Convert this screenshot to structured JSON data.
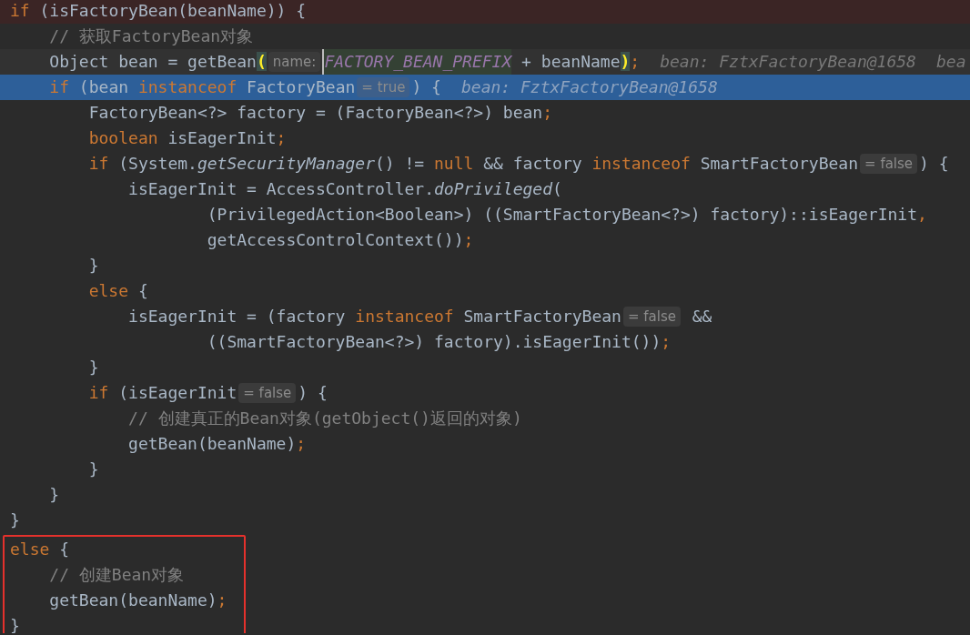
{
  "code_lines": [
    {
      "kind": "breakpoint",
      "tokens": [
        {
          "kind": "keyword",
          "text": "if"
        },
        {
          "kind": "text",
          "text": " (isFactoryBean(beanName)) {"
        }
      ]
    },
    {
      "tokens": [
        {
          "kind": "comment",
          "text": "    // 获取FactoryBean对象"
        }
      ]
    },
    {
      "kind": "caret",
      "tokens": [
        {
          "kind": "text",
          "text": "    Object bean = getBean"
        },
        {
          "kind": "brace",
          "text": "("
        },
        {
          "kind": "hint",
          "text": "name:"
        },
        {
          "kind": "constant",
          "text": "FACTORY_BEAN_PREFIX"
        },
        {
          "kind": "text",
          "text": " + beanName"
        },
        {
          "kind": "brace",
          "text": ")"
        },
        {
          "kind": "keyword",
          "text": ";"
        },
        {
          "kind": "value",
          "text": "bean: FztxFactoryBean@1658"
        },
        {
          "kind": "value",
          "text": "bea"
        }
      ]
    },
    {
      "kind": "execution",
      "tokens": [
        {
          "kind": "keyword",
          "text": "    if"
        },
        {
          "kind": "text",
          "text": " (bean "
        },
        {
          "kind": "keyword",
          "text": "instanceof"
        },
        {
          "kind": "text",
          "text": " FactoryBean"
        },
        {
          "kind": "hint",
          "text": "= true"
        },
        {
          "kind": "text",
          "text": ") {"
        },
        {
          "kind": "value",
          "text": "bean: FztxFactoryBean@1658"
        }
      ]
    },
    {
      "tokens": [
        {
          "kind": "text",
          "text": "        FactoryBean<?> factory = (FactoryBean<?>) bean"
        },
        {
          "kind": "keyword",
          "text": ";"
        }
      ]
    },
    {
      "tokens": [
        {
          "kind": "keyword",
          "text": "        boolean"
        },
        {
          "kind": "text",
          "text": " isEagerInit"
        },
        {
          "kind": "keyword",
          "text": ";"
        }
      ]
    },
    {
      "tokens": [
        {
          "kind": "keyword",
          "text": "        if"
        },
        {
          "kind": "text",
          "text": " (System."
        },
        {
          "kind": "italic",
          "text": "getSecurityManager"
        },
        {
          "kind": "text",
          "text": "() != "
        },
        {
          "kind": "keyword",
          "text": "null"
        },
        {
          "kind": "text",
          "text": " && factory "
        },
        {
          "kind": "keyword",
          "text": "instanceof"
        },
        {
          "kind": "text",
          "text": " SmartFactoryBean"
        },
        {
          "kind": "hint",
          "text": "= false"
        },
        {
          "kind": "text",
          "text": ") {"
        }
      ]
    },
    {
      "tokens": [
        {
          "kind": "text",
          "text": "            isEagerInit = AccessController."
        },
        {
          "kind": "italic",
          "text": "doPrivileged"
        },
        {
          "kind": "text",
          "text": "("
        }
      ]
    },
    {
      "tokens": [
        {
          "kind": "text",
          "text": "                    (PrivilegedAction<Boolean>) ((SmartFactoryBean<?>) factory)::isEagerInit"
        },
        {
          "kind": "keyword",
          "text": ","
        }
      ]
    },
    {
      "tokens": [
        {
          "kind": "text",
          "text": "                    getAccessControlContext())"
        },
        {
          "kind": "keyword",
          "text": ";"
        }
      ]
    },
    {
      "tokens": [
        {
          "kind": "text",
          "text": "        }"
        }
      ]
    },
    {
      "tokens": [
        {
          "kind": "keyword",
          "text": "        else"
        },
        {
          "kind": "text",
          "text": " {"
        }
      ]
    },
    {
      "tokens": [
        {
          "kind": "text",
          "text": "            isEagerInit = (factory "
        },
        {
          "kind": "keyword",
          "text": "instanceof"
        },
        {
          "kind": "text",
          "text": " SmartFactoryBean"
        },
        {
          "kind": "hint",
          "text": "= false"
        },
        {
          "kind": "text",
          "text": " &&"
        }
      ]
    },
    {
      "tokens": [
        {
          "kind": "text",
          "text": "                    ((SmartFactoryBean<?>) factory).isEagerInit())"
        },
        {
          "kind": "keyword",
          "text": ";"
        }
      ]
    },
    {
      "tokens": [
        {
          "kind": "text",
          "text": "        }"
        }
      ]
    },
    {
      "tokens": [
        {
          "kind": "keyword",
          "text": "        if"
        },
        {
          "kind": "text",
          "text": " (isEagerInit"
        },
        {
          "kind": "hint",
          "text": "= false"
        },
        {
          "kind": "text",
          "text": ") {"
        }
      ]
    },
    {
      "tokens": [
        {
          "kind": "comment",
          "text": "            // 创建真正的Bean对象(getObject()返回的对象)"
        }
      ]
    },
    {
      "tokens": [
        {
          "kind": "text",
          "text": "            getBean(beanName)"
        },
        {
          "kind": "keyword",
          "text": ";"
        }
      ]
    },
    {
      "tokens": [
        {
          "kind": "text",
          "text": "        }"
        }
      ]
    },
    {
      "tokens": [
        {
          "kind": "text",
          "text": "    }"
        }
      ]
    },
    {
      "tokens": [
        {
          "kind": "text",
          "text": "}"
        }
      ]
    }
  ],
  "highlighted_block": {
    "lines": [
      {
        "tokens": [
          {
            "kind": "keyword",
            "text": "else"
          },
          {
            "kind": "text",
            "text": " {"
          }
        ]
      },
      {
        "tokens": [
          {
            "kind": "comment",
            "text": "    // 创建Bean对象"
          }
        ]
      },
      {
        "tokens": [
          {
            "kind": "text",
            "text": "    getBean(beanName)"
          },
          {
            "kind": "keyword",
            "text": ";"
          }
        ]
      },
      {
        "tokens": [
          {
            "kind": "text",
            "text": "}"
          }
        ]
      }
    ]
  }
}
